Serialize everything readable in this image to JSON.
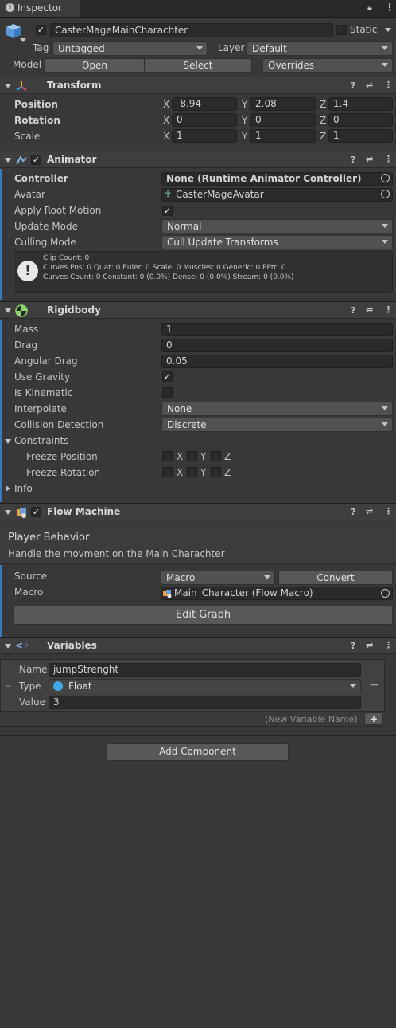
{
  "tab": {
    "label": "Inspector"
  },
  "object": {
    "name": "CasterMageMainCharachter",
    "static_label": "Static",
    "tag_label": "Tag",
    "tag_value": "Untagged",
    "layer_label": "Layer",
    "layer_value": "Default",
    "model_label": "Model",
    "open_label": "Open",
    "select_label": "Select",
    "overrides_label": "Overrides"
  },
  "transform": {
    "title": "Transform",
    "position_label": "Position",
    "rotation_label": "Rotation",
    "scale_label": "Scale",
    "position": {
      "x": "-8.94",
      "y": "2.08",
      "z": "1.4"
    },
    "rotation": {
      "x": "0",
      "y": "0",
      "z": "0"
    },
    "scale": {
      "x": "1",
      "y": "1",
      "z": "1"
    }
  },
  "axes": {
    "x": "X",
    "y": "Y",
    "z": "Z"
  },
  "animator": {
    "title": "Animator",
    "controller_label": "Controller",
    "controller_value": "None (Runtime Animator Controller)",
    "avatar_label": "Avatar",
    "avatar_value": "CasterMageAvatar",
    "apply_root_label": "Apply Root Motion",
    "update_mode_label": "Update Mode",
    "update_mode_value": "Normal",
    "culling_label": "Culling Mode",
    "culling_value": "Cull Update Transforms",
    "info_line1": "Clip Count: 0",
    "info_line2": "Curves Pos: 0 Quat: 0 Euler: 0 Scale: 0 Muscles: 0 Generic: 0 PPtr: 0",
    "info_line3": "Curves Count: 0 Constant: 0 (0.0%) Dense: 0 (0.0%) Stream: 0 (0.0%)"
  },
  "rigidbody": {
    "title": "Rigidbody",
    "mass_label": "Mass",
    "mass_value": "1",
    "drag_label": "Drag",
    "drag_value": "0",
    "angular_label": "Angular Drag",
    "angular_value": "0.05",
    "gravity_label": "Use Gravity",
    "kinematic_label": "Is Kinematic",
    "interpolate_label": "Interpolate",
    "interpolate_value": "None",
    "collision_label": "Collision Detection",
    "collision_value": "Discrete",
    "constraints_label": "Constraints",
    "freeze_pos_label": "Freeze Position",
    "freeze_rot_label": "Freeze Rotation",
    "info_label": "Info"
  },
  "flow": {
    "title": "Flow Machine",
    "behavior_title": "Player Behavior",
    "behavior_desc": "Handle the movment on the Main Charachter",
    "source_label": "Source",
    "source_value": "Macro",
    "convert_label": "Convert",
    "macro_label": "Macro",
    "macro_value": "Main_Character (Flow Macro)",
    "edit_graph_label": "Edit Graph"
  },
  "variables": {
    "title": "Variables",
    "name_label": "Name",
    "name_value": "jumpStrenght",
    "type_label": "Type",
    "type_value": "Float",
    "value_label": "Value",
    "value_value": "3",
    "new_placeholder": "(New Variable Name)",
    "remove_label": "−",
    "add_label": "+"
  },
  "add_component_label": "Add Component"
}
